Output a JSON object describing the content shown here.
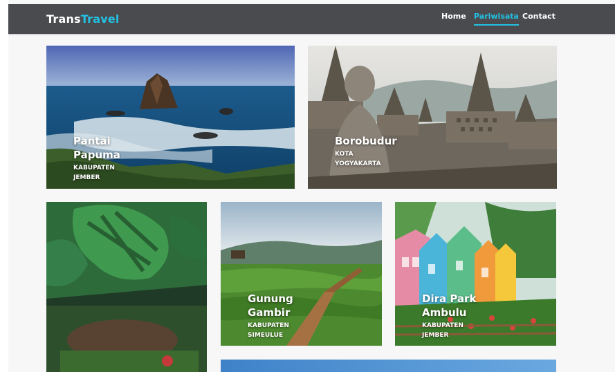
{
  "brand": {
    "part1": "Trans",
    "part2": "Travel"
  },
  "nav": {
    "items": [
      {
        "label": "Home"
      },
      {
        "label": "Pariwisata"
      },
      {
        "label": "Contact"
      }
    ]
  },
  "colors": {
    "accent": "#22c2e4",
    "navbar": "#4a4b4f"
  },
  "cards": [
    {
      "title": "Pantai\nPapuma",
      "subtitle": "KABUPATEN\nJEMBER"
    },
    {
      "title": "Borobudur",
      "subtitle": "KOTA\nYOGYAKARTA"
    },
    {
      "title": "",
      "subtitle": ""
    },
    {
      "title": "Gunung\nGambir",
      "subtitle": "KABUPATEN\nSIMEULUE"
    },
    {
      "title": "Dira Park\nAmbulu",
      "subtitle": "KABUPATEN\nJEMBER"
    }
  ]
}
